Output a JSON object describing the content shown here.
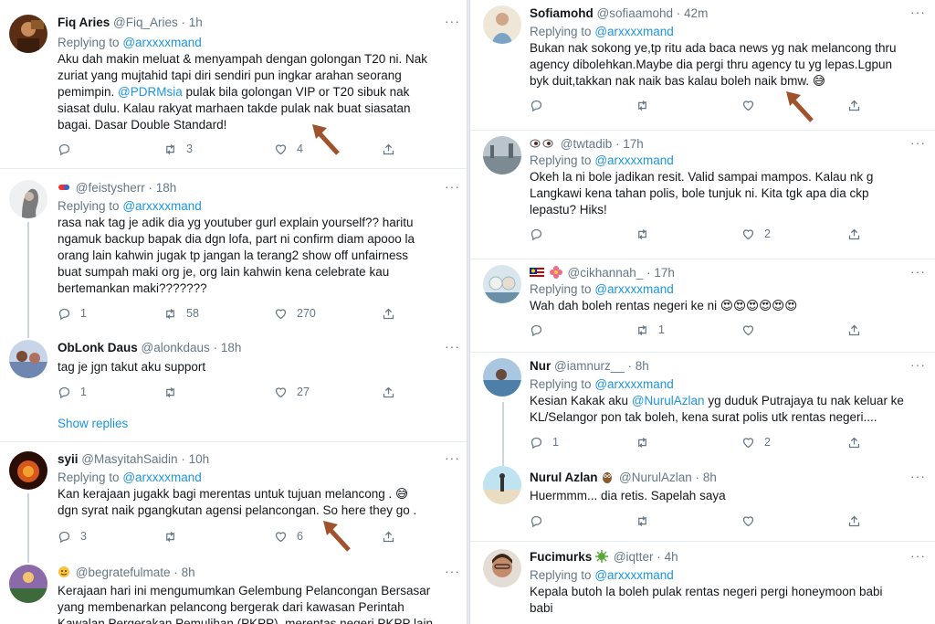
{
  "replying_to_label": "Replying to",
  "replying_to_handle": "@arxxxxmand",
  "left_tweets": [
    {
      "name": "Fiq Aries",
      "handle": "@Fiq_Aries",
      "time": "1h",
      "text_pre": "Aku dah makin meluat & menyampah dengan golongan T20 ni. Nak\nzuriat yang mujtahid tapi diri sendiri pun ingkar arahan seorang\npemimpin. ",
      "mention": "@PDRMsia",
      "text_post": " pulak bila golongan VIP or T20 sibuk nak\nsiasat dulu. Kalau rakyat marhaen takde pulak nak buat siasatan\nbagai. Dasar Double Standard!",
      "reply_count": "",
      "retweet_count": "3",
      "like_count": "4"
    },
    {
      "name": "",
      "handle": "@feistysherr",
      "time": "18h",
      "text": "rasa nak tag je adik dia yg youtuber gurl explain yourself?? haritu\nngamuk backup bapak dia dgn lofa, part ni confirm diam apooo la\norang lain kahwin jugak tp jangan la terang2 show off unfairness\nbuat sumpah maki org je, org lain kahwin kena celebrate kau\nbertemankan maki???????",
      "reply_count": "1",
      "retweet_count": "58",
      "like_count": "270"
    },
    {
      "name": "ObLonk Daus",
      "handle": "@alonkdaus",
      "time": "18h",
      "text": "tag je jgn takut aku support",
      "reply_count": "1",
      "retweet_count": "",
      "like_count": "27"
    },
    {
      "name": "syii",
      "handle": "@MasyitahSaidin",
      "time": "10h",
      "text": "Kan kerajaan jugakk bagi merentas untuk tujuan melancong . 😅\ndgn syrat naik pgangkutan agensi pelancongan. So here they go .",
      "reply_count": "3",
      "retweet_count": "",
      "like_count": "6"
    },
    {
      "name": "",
      "handle": "@begratefulmate",
      "time": "8h",
      "text": "Kerajaan hari ini mengumumkan Gelembung Pelancongan Bersasar\nyang membenarkan pelancong bergerak dari kawasan Perintah\nKawalan Pergerakan Pemulihan (PKPP), merentas negeri PKPP lain"
    }
  ],
  "show_replies": "Show replies",
  "right_tweets": [
    {
      "name": "Sofiamohd",
      "handle": "@sofiaamohd",
      "time": "42m",
      "text": "Bukan nak sokong ye,tp ritu ada baca news yg nak melancong thru\nagency dibolehkan.Maybe dia pergi thru agency tu yg lepas.Lgpun\nbyk duit,takkan nak naik bas kalau boleh naik bmw. 😅",
      "reply_count": "",
      "retweet_count": "",
      "like_count": ""
    },
    {
      "name": "",
      "handle": "@twtadib",
      "time": "17h",
      "text": "Okeh la ni bole jadikan resit. Valid sampai mampos. Kalau nk g\nLangkawi kena tahan polis, bole tunjuk ni. Kita tgk apa dia ckp\nlepastu? Hiks!",
      "reply_count": "",
      "retweet_count": "",
      "like_count": "2"
    },
    {
      "name": "",
      "handle": "@cikhannah_",
      "time": "17h",
      "text": "Wah dah boleh rentas negeri ke ni 😍😍😍😍😍😍",
      "reply_count": "",
      "retweet_count": "1",
      "like_count": ""
    },
    {
      "name": "Nur",
      "handle": "@iamnurz__",
      "time": "8h",
      "text_pre": "Kesian Kakak aku ",
      "mention": "@NurulAzlan",
      "text_post": " yg duduk Putrajaya tu nak keluar ke\nKL/Selangor pon tak boleh, kena surat polis utk rentas negeri....",
      "reply_count": "1",
      "retweet_count": "",
      "like_count": "2"
    },
    {
      "name": "Nurul Azlan",
      "handle": "@NurulAzlan",
      "time": "8h",
      "text": "Huermmm... dia retis. Sapelah saya",
      "reply_count": "",
      "retweet_count": "",
      "like_count": ""
    },
    {
      "name": "Fucimurks",
      "handle": "@iqtter",
      "time": "4h",
      "text": "Kepala butoh la boleh pulak rentas negeri pergi honeymoon babi\nbabi"
    }
  ],
  "colors": {
    "link": "#1b95e0",
    "muted": "#657786",
    "arrow": "#a0522d"
  }
}
